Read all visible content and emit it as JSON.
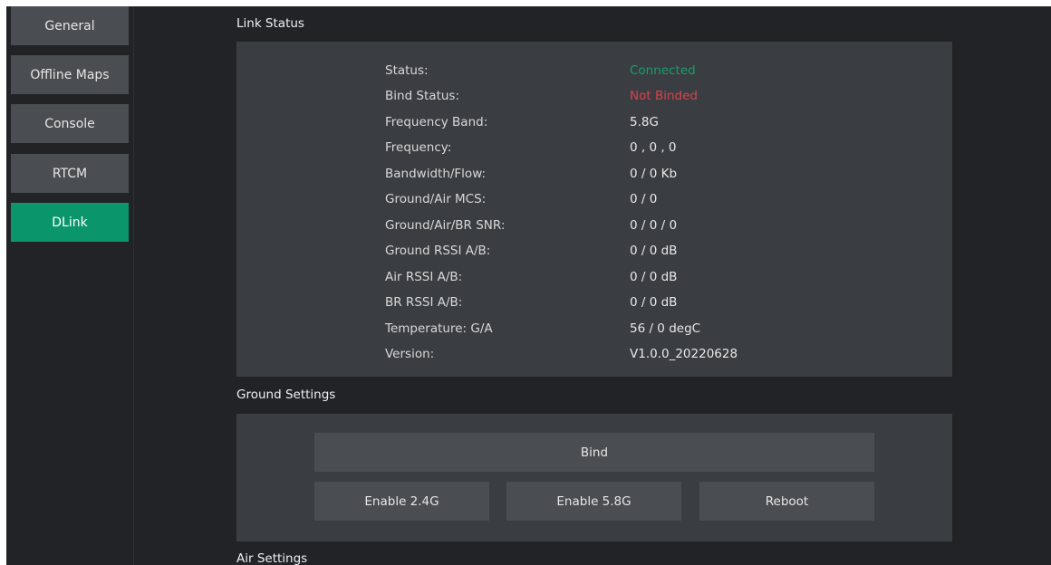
{
  "sidebar": {
    "items": [
      {
        "label": "General"
      },
      {
        "label": "Offline Maps"
      },
      {
        "label": "Console"
      },
      {
        "label": "RTCM"
      },
      {
        "label": "DLink"
      }
    ],
    "active": "DLink",
    "active_color": "#0a956a"
  },
  "link_status": {
    "title": "Link Status",
    "rows": [
      {
        "label": "Status:",
        "value": "Connected"
      },
      {
        "label": "Bind Status:",
        "value": "Not Binded"
      },
      {
        "label": "Frequency Band:",
        "value": "5.8G"
      },
      {
        "label": "Frequency:",
        "value": "0 , 0 , 0"
      },
      {
        "label": "Bandwidth/Flow:",
        "value": "0 / 0 Kb"
      },
      {
        "label": "Ground/Air MCS:",
        "value": "0 / 0"
      },
      {
        "label": "Ground/Air/BR SNR:",
        "value": "0 / 0 / 0"
      },
      {
        "label": "Ground RSSI A/B:",
        "value": "0 / 0 dB"
      },
      {
        "label": "Air RSSI A/B:",
        "value": "0 / 0 dB"
      },
      {
        "label": "BR RSSI A/B:",
        "value": "0 / 0 dB"
      },
      {
        "label": "Temperature: G/A",
        "value": "56 / 0 degC"
      },
      {
        "label": "Version:",
        "value": "V1.0.0_20220628"
      }
    ],
    "status_color": "#14a06a",
    "bind_status_color": "#d9434a"
  },
  "ground_settings": {
    "title": "Ground Settings",
    "bind_label": "Bind",
    "enable_24_label": "Enable 2.4G",
    "enable_58_label": "Enable 5.8G",
    "reboot_label": "Reboot"
  },
  "air_settings": {
    "title": "Air Settings"
  }
}
